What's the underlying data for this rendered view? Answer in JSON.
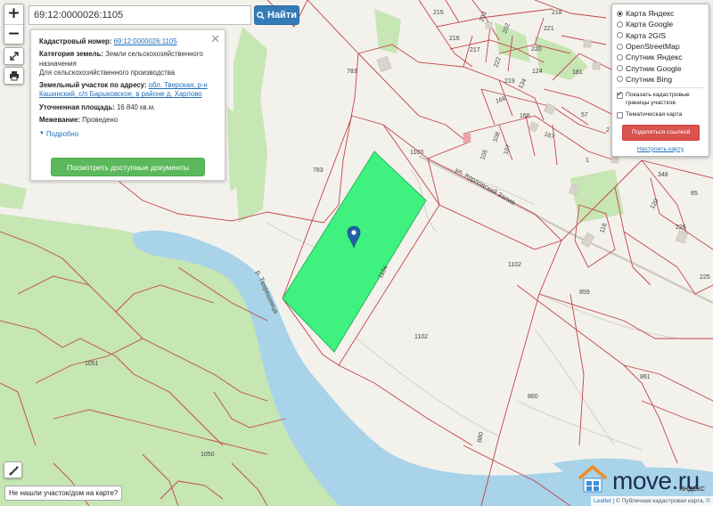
{
  "search": {
    "value": "69:12:0000026:1105",
    "button_label": "Найти"
  },
  "info_panel": {
    "cadastral_label": "Кадастровый номер:",
    "cadastral_value": "69:12:0000026:1105",
    "category_label": "Категория земель:",
    "category_value": "Земли сельскохозяйственного назначения",
    "usage_value": "Для сельскохозяйственного производства",
    "address_label": "Земельный участок по адресу:",
    "address_value": "обл. Тверская, р-н Кашинский, с/п Барыковское, в районе д. Харлово",
    "area_label": "Уточненная площадь:",
    "area_value": "16 840 кв.м.",
    "survey_label": "Межевание:",
    "survey_value": "Проведено",
    "more_label": "Подробно",
    "docs_button": "Посмотреть доступные документы"
  },
  "layers": {
    "options": [
      {
        "label": "Карта Яндекс",
        "selected": true
      },
      {
        "label": "Карта Google",
        "selected": false
      },
      {
        "label": "Карта 2GIS",
        "selected": false
      },
      {
        "label": "OpenStreetMap",
        "selected": false
      },
      {
        "label": "Спутник Яндекс",
        "selected": false
      },
      {
        "label": "Спутник Google",
        "selected": false
      },
      {
        "label": "Спутник Bing",
        "selected": false
      }
    ],
    "show_borders_label": "Показать кадастровые границы участков",
    "show_borders_checked": true,
    "thematic_label": "Тематическая карта",
    "thematic_checked": false,
    "share_button": "Поделиться ссылкой",
    "setup_link": "Настроить карту"
  },
  "map": {
    "street": "ул. Хорловский Залив",
    "river": "р. Тверешница",
    "labels": [
      "783",
      "783",
      "1103",
      "1104",
      "1102",
      "1102",
      "859",
      "860",
      "861",
      "1051",
      "1050",
      "880",
      "348",
      "85",
      "120",
      "226",
      "118",
      "225",
      "215",
      "216",
      "217",
      "203",
      "202",
      "220",
      "221",
      "218",
      "222",
      "219",
      "124",
      "134",
      "181",
      "57",
      "166",
      "168",
      "108",
      "167",
      "107",
      "105",
      "1",
      "2",
      "1104"
    ],
    "colors": {
      "parcel": "#3ff280",
      "water": "#a8d3e8",
      "forest": "#c6e6b3",
      "land": "#f3f1ec",
      "border": "#c2444b",
      "pin": "#1f63a6"
    }
  },
  "not_found_label": "Не нашли участок/дом на карте?",
  "attribution": {
    "leaflet": "Leaflet",
    "text": "| © Публичная кадастровая карта, ©"
  },
  "watermark": {
    "text": "move.ru",
    "yandex": "ЯНДЕКС"
  },
  "icons": [
    "zoom-in-icon",
    "zoom-out-icon",
    "fullscreen-icon",
    "print-icon",
    "search-icon",
    "close-icon",
    "chevron-down-icon",
    "map-pin-icon",
    "ruler-icon",
    "house-logo-icon"
  ]
}
